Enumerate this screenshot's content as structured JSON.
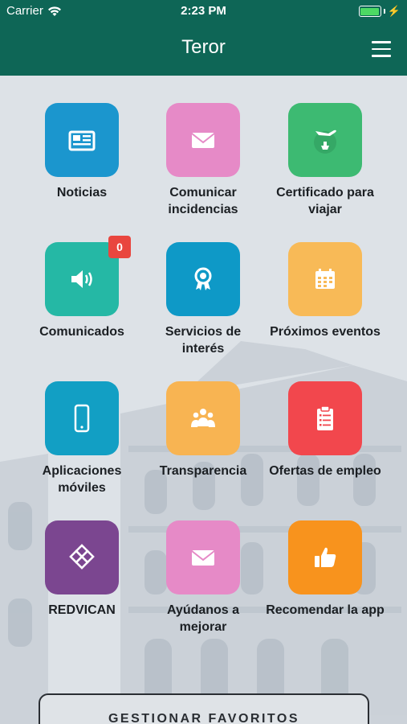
{
  "status_bar": {
    "carrier": "Carrier",
    "time": "2:23 PM"
  },
  "header": {
    "title": "Teror",
    "menu_icon": "hamburger-icon"
  },
  "tiles": [
    {
      "label": "Noticias",
      "color": "#1b96ce",
      "icon": "newspaper-icon"
    },
    {
      "label": "Comunicar incidencias",
      "color": "#e68ac7",
      "icon": "envelope-icon"
    },
    {
      "label": "Certificado para viajar",
      "color": "#3dba72",
      "icon": "plane-ship-icon"
    },
    {
      "label": "Comunicados",
      "color": "#25b8a5",
      "icon": "speaker-icon",
      "badge": "0"
    },
    {
      "label": "Servicios de interés",
      "color": "#0e99c7",
      "icon": "award-icon"
    },
    {
      "label": "Próximos eventos",
      "color": "#f8ba57",
      "icon": "calendar-icon"
    },
    {
      "label": "Aplicaciones móviles",
      "color": "#129fc4",
      "icon": "smartphone-icon"
    },
    {
      "label": "Transparencia",
      "color": "#f8b452",
      "icon": "people-icon"
    },
    {
      "label": "Ofertas de empleo",
      "color": "#f2474d",
      "icon": "clipboard-icon"
    },
    {
      "label": "REDVICAN",
      "color": "#7b4690",
      "icon": "redvican-logo-icon"
    },
    {
      "label": "Ayúdanos a mejorar",
      "color": "#e68ac7",
      "icon": "envelope-icon"
    },
    {
      "label": "Recomendar la app",
      "color": "#f8931d",
      "icon": "thumbs-up-icon"
    }
  ],
  "favorites_button": {
    "label": "GESTIONAR FAVORITOS"
  }
}
